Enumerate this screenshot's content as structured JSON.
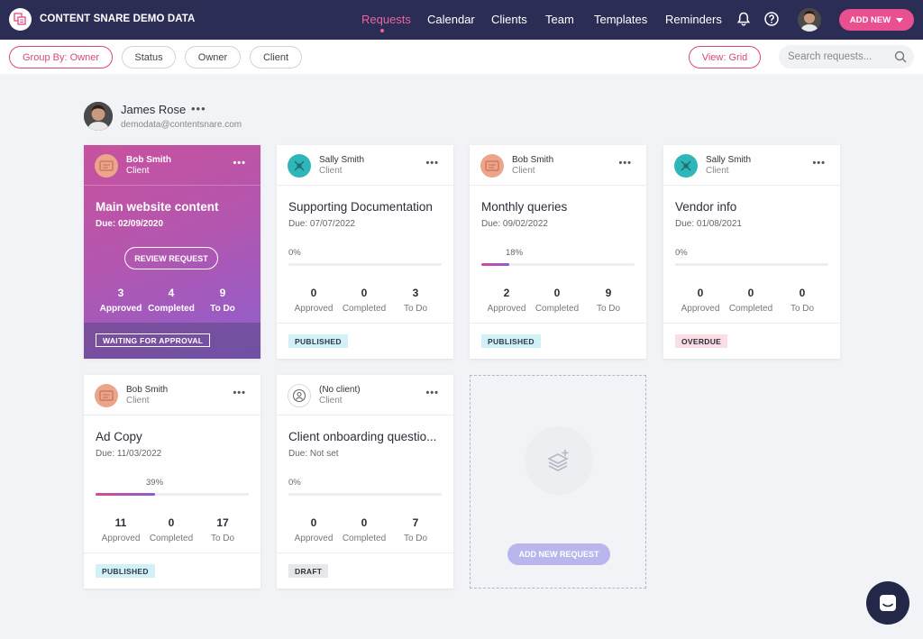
{
  "brand": {
    "name": "CONTENT SNARE DEMO DATA"
  },
  "nav": {
    "items": [
      "Requests",
      "Calendar",
      "Clients",
      "Team",
      "Templates",
      "Reminders"
    ],
    "add_new": "ADD NEW"
  },
  "filters": {
    "group_by": "Group By: Owner",
    "status": "Status",
    "owner": "Owner",
    "client": "Client",
    "view": "View: Grid",
    "search_placeholder": "Search requests..."
  },
  "owner": {
    "name": "James Rose",
    "email": "demodata@contentsnare.com"
  },
  "cards": [
    {
      "client": "Bob Smith",
      "role": "Client",
      "title": "Main website content",
      "due": "Due:  02/09/2020",
      "review": "REVIEW REQUEST",
      "approved": "3",
      "completed": "4",
      "todo": "9",
      "status": "WAITING FOR APPROVAL"
    },
    {
      "client": "Sally Smith",
      "role": "Client",
      "title": "Supporting Documentation",
      "due": "Due:  07/07/2022",
      "pct": "0%",
      "progress": 0,
      "approved": "0",
      "completed": "0",
      "todo": "3",
      "status": "PUBLISHED"
    },
    {
      "client": "Bob Smith",
      "role": "Client",
      "title": "Monthly queries",
      "due": "Due:  09/02/2022",
      "pct": "18%",
      "progress": 0.18,
      "approved": "2",
      "completed": "0",
      "todo": "9",
      "status": "PUBLISHED"
    },
    {
      "client": "Sally Smith",
      "role": "Client",
      "title": "Vendor info",
      "due": "Due:  01/08/2021",
      "pct": "0%",
      "progress": 0,
      "approved": "0",
      "completed": "0",
      "todo": "0",
      "status": "OVERDUE"
    },
    {
      "client": "Bob Smith",
      "role": "Client",
      "title": "Ad Copy",
      "due": "Due:  11/03/2022",
      "pct": "39%",
      "progress": 0.39,
      "approved": "11",
      "completed": "0",
      "todo": "17",
      "status": "PUBLISHED"
    },
    {
      "client": "(No client)",
      "role": "Client",
      "title": "Client onboarding questio...",
      "due": "Due:  Not set",
      "pct": "0%",
      "progress": 0,
      "approved": "0",
      "completed": "0",
      "todo": "7",
      "status": "DRAFT"
    }
  ],
  "stat_labels": {
    "approved": "Approved",
    "completed": "Completed",
    "todo": "To Do"
  },
  "add_request": "ADD NEW REQUEST",
  "colors": {
    "nav_bg": "#2b2d55",
    "accent": "#e8508f",
    "teal_avatar": "#2fb6b8",
    "peach_avatar": "#eaa58a"
  }
}
